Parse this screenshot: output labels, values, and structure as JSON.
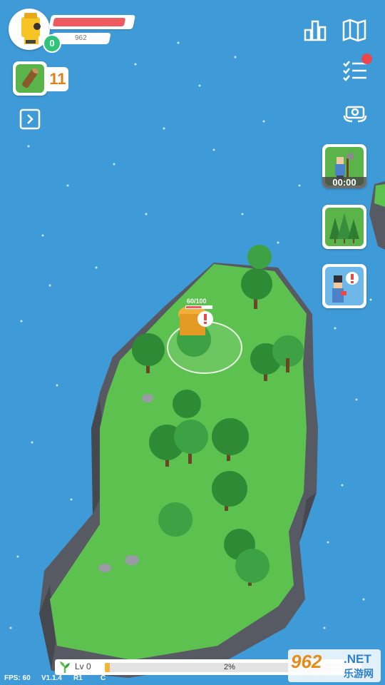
{
  "player": {
    "level": "0",
    "coins": "962",
    "health_fraction": 0.93
  },
  "inventory": {
    "wood_count": "11",
    "wood_icon": "wood-log-icon"
  },
  "top_right_icons": [
    "stats-icon",
    "map-icon",
    "task-list-icon",
    "camera-rotate-icon"
  ],
  "side_panel": {
    "lumberjack_timer": "00:00",
    "cards": [
      "hire-lumberjack-icon",
      "forest-icon",
      "villager-alert-icon"
    ]
  },
  "target_tree": {
    "hp_text": "60/100",
    "hp_fraction": 0.6
  },
  "experience": {
    "level_label": "Lv  0",
    "progress_text": "2%",
    "progress_fraction": 0.02
  },
  "debug": {
    "fps": "FPS: 60",
    "version": "V1.1.4",
    "r_label": "R1",
    "c_label": "C"
  },
  "watermark": {
    "logo": "962",
    "net": ".NET",
    "subtitle": "乐游网"
  },
  "colors": {
    "water": "#3f9bd8",
    "grass": "#5cc14f",
    "cliff": "#5b5d66",
    "health": "#ee5a60",
    "level_badge": "#2fc47a",
    "wood_count": "#e07e1c",
    "xp_fill": "#f2b53a"
  }
}
